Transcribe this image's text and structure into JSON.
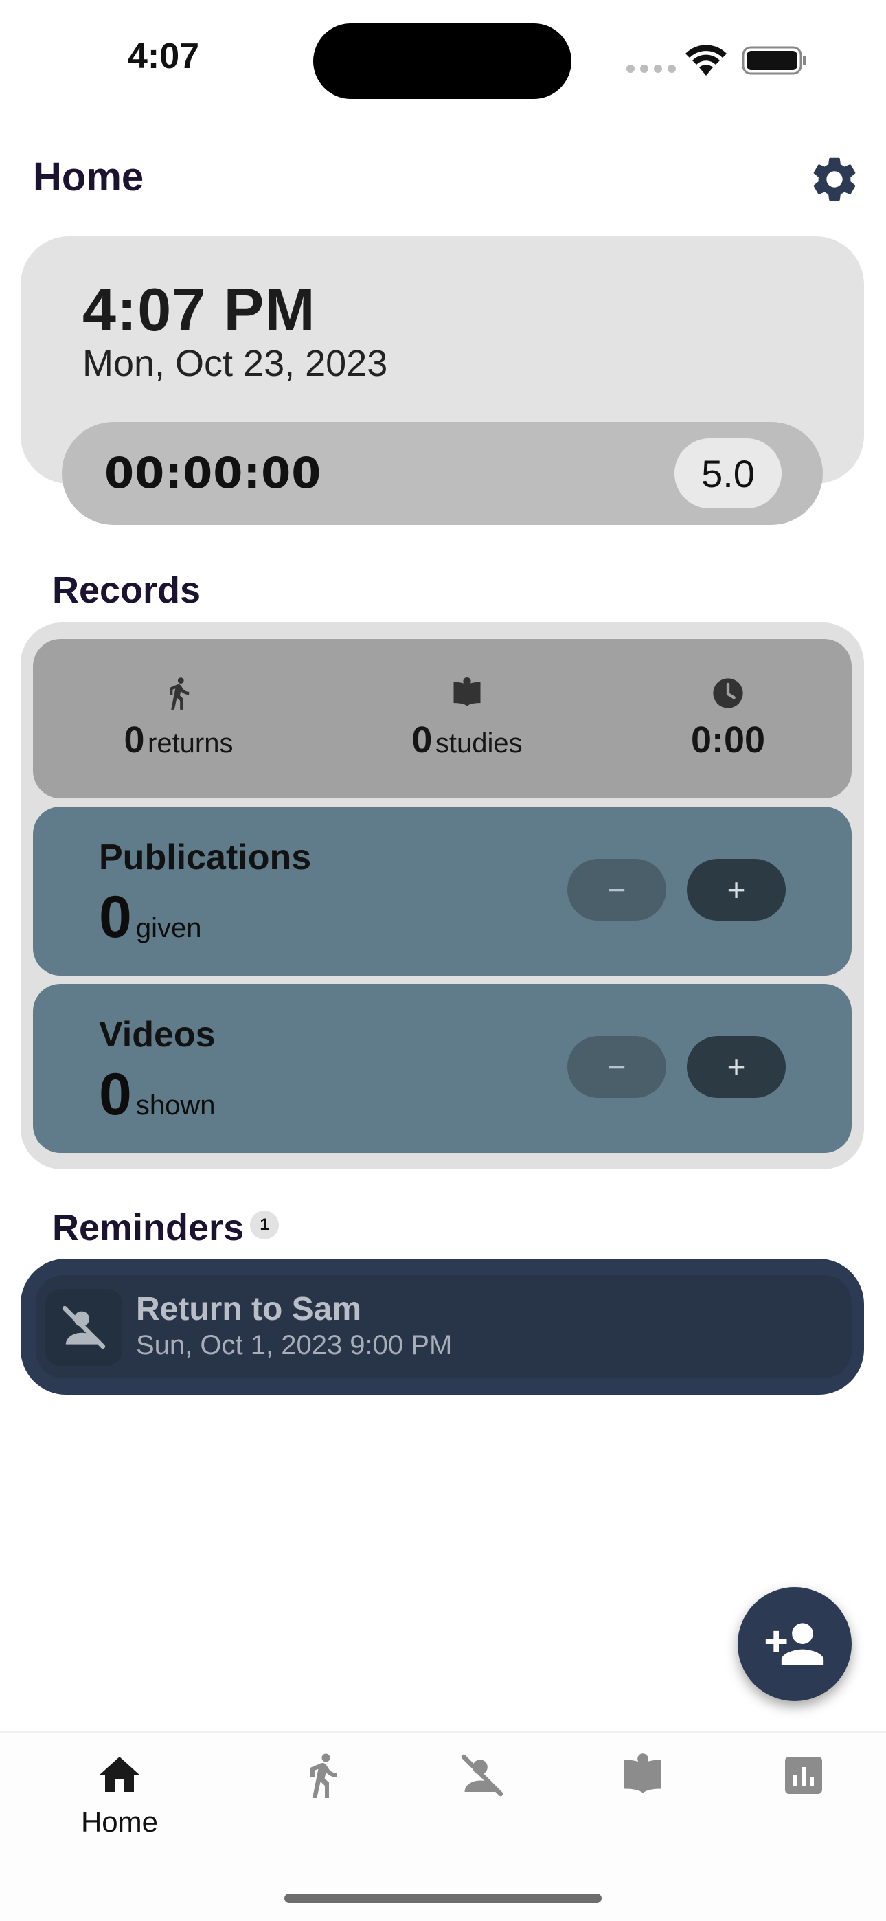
{
  "status_bar": {
    "time": "4:07"
  },
  "header": {
    "title": "Home",
    "settings_icon": "gear-icon"
  },
  "clock": {
    "time": "4:07 PM",
    "date": "Mon, Oct 23, 2023",
    "timer": "00:00:00",
    "rate": "5.0"
  },
  "records": {
    "title": "Records",
    "stats": [
      {
        "icon": "walking-person-icon",
        "value": "0",
        "unit": "returns"
      },
      {
        "icon": "open-book-icon",
        "value": "0",
        "unit": "studies"
      },
      {
        "icon": "clock-icon",
        "value": "0:00",
        "unit": ""
      }
    ],
    "publications": {
      "title": "Publications",
      "value": "0",
      "unit": "given",
      "minus_label": "−",
      "plus_label": "+"
    },
    "videos": {
      "title": "Videos",
      "value": "0",
      "unit": "shown",
      "minus_label": "−",
      "plus_label": "+"
    }
  },
  "reminders": {
    "title": "Reminders",
    "count": "1",
    "items": [
      {
        "icon": "person-off-icon",
        "name": "Return to Sam",
        "date": "Sun, Oct 1, 2023 9:00 PM"
      }
    ]
  },
  "fab": {
    "icon": "add-person-icon"
  },
  "bottom_nav": {
    "items": [
      {
        "icon": "home-icon",
        "label": "Home",
        "active": true
      },
      {
        "icon": "walking-person-icon",
        "label": ""
      },
      {
        "icon": "person-off-icon",
        "label": ""
      },
      {
        "icon": "open-book-icon",
        "label": ""
      },
      {
        "icon": "bar-chart-icon",
        "label": ""
      }
    ]
  },
  "colors": {
    "primary_dark": "#2c3b53",
    "counter_card": "#607b89",
    "stats_card": "#a1a1a1",
    "clock_card": "#e3e3e3",
    "timer_pill": "#bdbdbd"
  }
}
